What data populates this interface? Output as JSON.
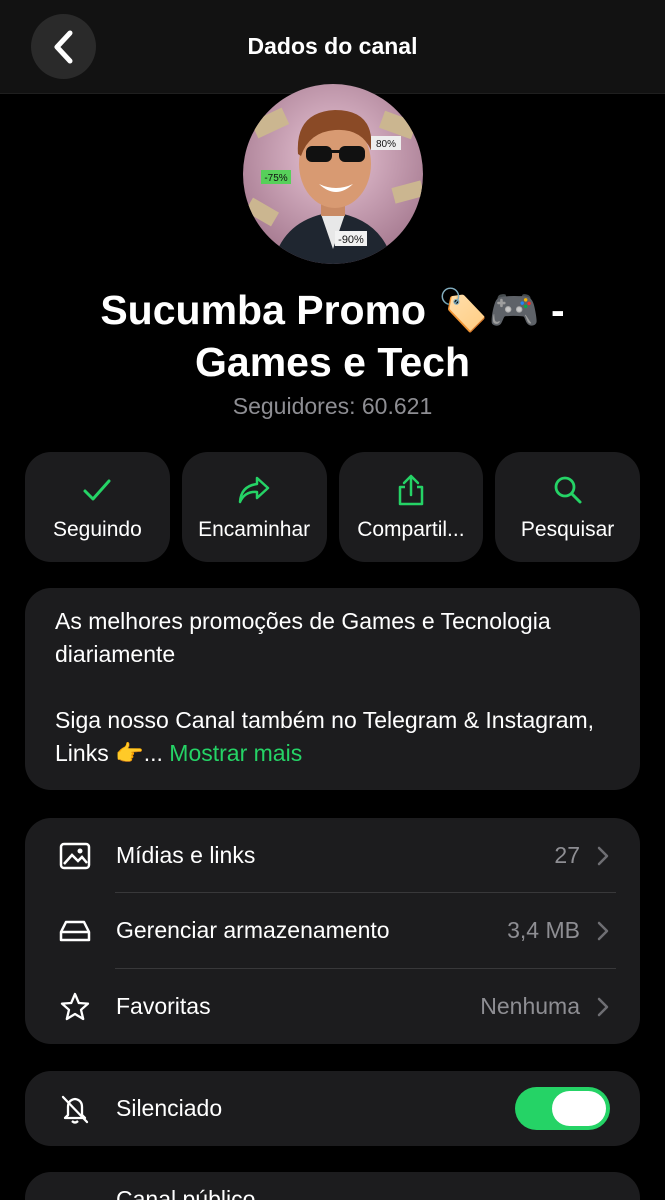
{
  "header": {
    "title": "Dados do canal",
    "back_icon": "chevron-left-icon"
  },
  "channel": {
    "name": "Sucumba Promo 🏷️🎮  - Games e Tech",
    "followers": "Seguidores: 60.621",
    "avatar_badges": [
      "-75%",
      "80%",
      "-90%"
    ]
  },
  "actions": [
    {
      "label": "Seguindo",
      "icon": "check-icon"
    },
    {
      "label": "Encaminhar",
      "icon": "forward-icon"
    },
    {
      "label": "Compartil...",
      "icon": "share-icon"
    },
    {
      "label": "Pesquisar",
      "icon": "search-icon"
    }
  ],
  "description": {
    "line1": "As melhores promoções de Games e Tecnologia diariamente",
    "line2": "Siga nosso Canal também no Telegram & Instagram, Links 👉...",
    "more": "Mostrar mais"
  },
  "list": [
    {
      "label": "Mídias e links",
      "value": "27",
      "icon": "image-icon"
    },
    {
      "label": "Gerenciar armazenamento",
      "value": "3,4 MB",
      "icon": "storage-icon"
    },
    {
      "label": "Favoritas",
      "value": "Nenhuma",
      "icon": "star-icon"
    }
  ],
  "mute": {
    "label": "Silenciado",
    "icon": "bell-off-icon",
    "enabled": true
  },
  "public": {
    "label": "Canal público"
  },
  "colors": {
    "accent": "#25d366",
    "card": "#1c1c1e",
    "secondary_text": "#8e8e93"
  }
}
